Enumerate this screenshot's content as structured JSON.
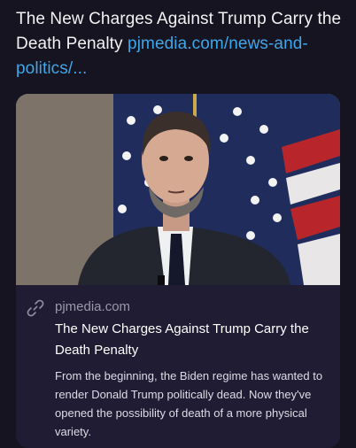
{
  "post": {
    "text": "The New Charges Against Trump Carry the Death Penalty",
    "link": "pjmedia.com/news-and-politics/..."
  },
  "link_card": {
    "domain": "pjmedia.com",
    "title": "The New Charges Against Trump Carry the Death Penalty",
    "description": "From the beginning, the Biden regime has wanted to render Donald Trump politically dead. Now they've opened the possibility of death of a more physical variety.",
    "link_icon": "chain-link-icon"
  },
  "colors": {
    "background": "#161420",
    "link": "#3fa6e8",
    "card_body": "#1f1c33"
  }
}
